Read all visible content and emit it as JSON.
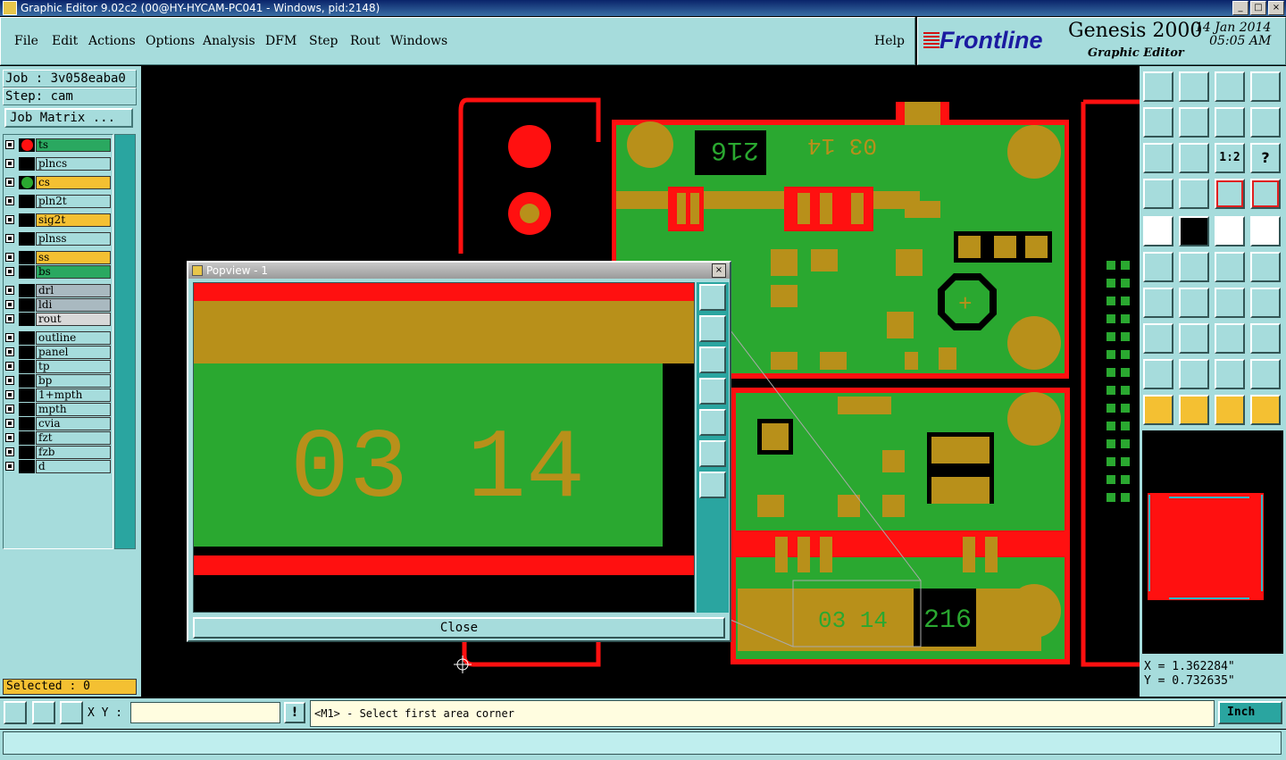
{
  "window": {
    "title": "Graphic Editor 9.02c2 (00@HY-HYCAM-PC041 - Windows, pid:2148)"
  },
  "menu": {
    "items": [
      "File",
      "Edit",
      "Actions",
      "Options",
      "Analysis",
      "DFM",
      "Step",
      "Rout",
      "Windows"
    ],
    "help": "Help"
  },
  "brand": {
    "logo": "Frontline",
    "product": "Genesis 2000",
    "module": "Graphic Editor",
    "date": "14 Jan 2014",
    "time": "05:05 AM"
  },
  "job": {
    "job_line": "Job : 3v058eaba0",
    "step_line": "Step: cam",
    "matrix_button": "Job Matrix ..."
  },
  "layers": [
    {
      "name": "ts",
      "color": "#2aa860",
      "dot": "#ff1010"
    },
    {
      "name": "plncs",
      "color": "#a6dcdc",
      "dot": ""
    },
    {
      "name": "cs",
      "color": "#f4c032",
      "dot": "#2aa830"
    },
    {
      "name": "pln2t",
      "color": "#a6dcdc",
      "dot": ""
    },
    {
      "name": "sig2t",
      "color": "#f4c032",
      "dot": ""
    },
    {
      "name": "plnss",
      "color": "#a6dcdc",
      "dot": ""
    },
    {
      "name": "ss",
      "color": "#f4c032",
      "dot": ""
    },
    {
      "name": "bs",
      "color": "#2aa860",
      "dot": ""
    },
    {
      "name": "drl",
      "color": "#a9b9c0",
      "dot": ""
    },
    {
      "name": "ldi",
      "color": "#a9b9c0",
      "dot": ""
    },
    {
      "name": "rout",
      "color": "#d8d8d8",
      "dot": ""
    },
    {
      "name": "outline",
      "color": "#a6dcdc",
      "dot": ""
    },
    {
      "name": "panel",
      "color": "#a6dcdc",
      "dot": ""
    },
    {
      "name": "tp",
      "color": "#a6dcdc",
      "dot": ""
    },
    {
      "name": "bp",
      "color": "#a6dcdc",
      "dot": ""
    },
    {
      "name": "1+mpth",
      "color": "#a6dcdc",
      "dot": ""
    },
    {
      "name": "mpth",
      "color": "#a6dcdc",
      "dot": ""
    },
    {
      "name": "cvia",
      "color": "#a6dcdc",
      "dot": ""
    },
    {
      "name": "fzt",
      "color": "#a6dcdc",
      "dot": ""
    },
    {
      "name": "fzb",
      "color": "#a6dcdc",
      "dot": ""
    },
    {
      "name": "d",
      "color": "#a6dcdc",
      "dot": ""
    }
  ],
  "selected": "Selected : 0",
  "canvas": {
    "label_216_top": "216",
    "label_0314_top": "03 14",
    "label_216_bottom": "216",
    "label_0314_bottom": "03 14"
  },
  "popview": {
    "title": "Popview - 1",
    "close_button": "Close",
    "digits": "03 14"
  },
  "coords": {
    "x": "X = 1.362284\"",
    "y": "Y = 0.732635\""
  },
  "bottom": {
    "xy_label": "X Y :",
    "xy_value": "",
    "excl": "!",
    "prompt": "<M1> - Select first area corner",
    "units": "Inch"
  },
  "colors": {
    "panel": "#a6dcdc",
    "pcb_green": "#2aa830",
    "pcb_gold": "#b8901a",
    "pcb_red": "#ff1010"
  }
}
